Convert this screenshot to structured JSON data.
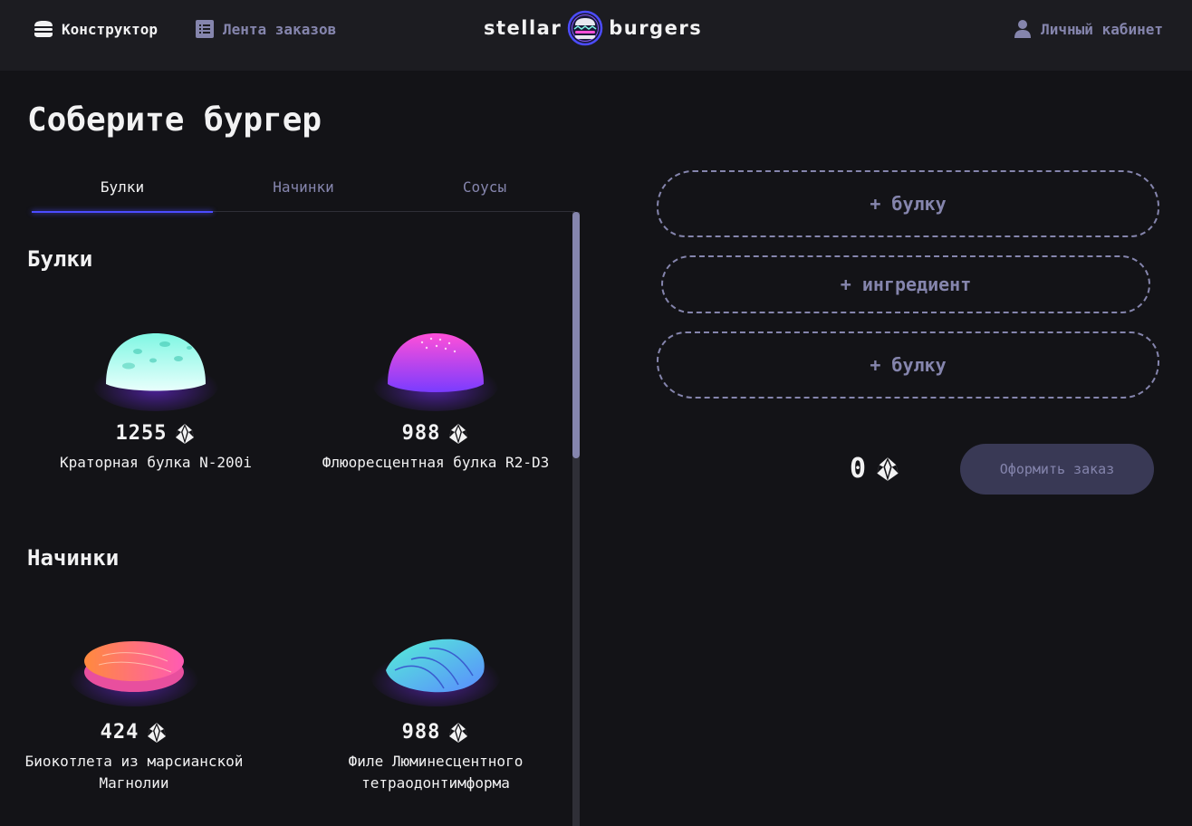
{
  "header": {
    "nav": {
      "constructor": "Конструктор",
      "feed": "Лента заказов",
      "account": "Личный кабинет"
    },
    "logo": {
      "left": "stellar",
      "right": "burgers"
    }
  },
  "main": {
    "title": "Соберите бургер",
    "tabs": [
      "Булки",
      "Начинки",
      "Соусы"
    ],
    "active_tab": "Булки",
    "sections": [
      {
        "title": "Булки",
        "items": [
          {
            "price": "1255",
            "name": "Краторная булка N-200i",
            "icon": "crater-bun"
          },
          {
            "price": "988",
            "name": "Флюоресцентная булка R2-D3",
            "icon": "fluorescent-bun"
          }
        ]
      },
      {
        "title": "Начинки",
        "items": [
          {
            "price": "424",
            "name": "Биокотлета из марсианской Магнолии",
            "icon": "bio-cutlet"
          },
          {
            "price": "988",
            "name": "Филе Люминесцентного тетраодонтимформа",
            "icon": "luminescent-fillet"
          }
        ]
      }
    ]
  },
  "constructor": {
    "top_slot": "+ булку",
    "middle_slot": "+ ингредиент",
    "bottom_slot": "+ булку",
    "total": "0",
    "order_button": "Оформить заказ"
  },
  "colors": {
    "background": "#131317",
    "header": "#1c1c21",
    "accent": "#4c4cff",
    "inactive": "#8585ad",
    "button_disabled": "#393955"
  }
}
